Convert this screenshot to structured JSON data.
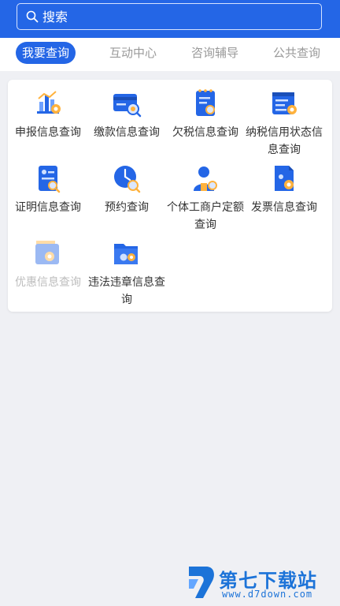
{
  "search": {
    "placeholder": "搜索"
  },
  "tabs": [
    {
      "label": "我要查询",
      "active": true
    },
    {
      "label": "互动中心"
    },
    {
      "label": "咨询辅导"
    },
    {
      "label": "公共查询"
    }
  ],
  "grid": {
    "items": [
      {
        "label": "申报信息查询",
        "icon": "chart-doc-icon"
      },
      {
        "label": "缴款信息查询",
        "icon": "payment-card-search-icon"
      },
      {
        "label": "欠税信息查询",
        "icon": "notebook-search-icon"
      },
      {
        "label": "纳税信用状态信息查询",
        "icon": "credit-list-icon"
      },
      {
        "label": "证明信息查询",
        "icon": "certificate-search-icon"
      },
      {
        "label": "预约查询",
        "icon": "clock-search-icon"
      },
      {
        "label": "个体工商户定额查询",
        "icon": "merchant-person-icon"
      },
      {
        "label": "发票信息查询",
        "icon": "invoice-gear-icon"
      },
      {
        "label": "优惠信息查询",
        "icon": "folder-gear-icon",
        "disabled": true
      },
      {
        "label": "违法违章信息查询",
        "icon": "folder-coins-icon"
      }
    ]
  },
  "watermark": {
    "title": "第七下载站",
    "url": "www.d7down.com"
  },
  "colors": {
    "primary": "#2466e6",
    "accent": "#ffb23d",
    "background": "#eff0f4"
  }
}
